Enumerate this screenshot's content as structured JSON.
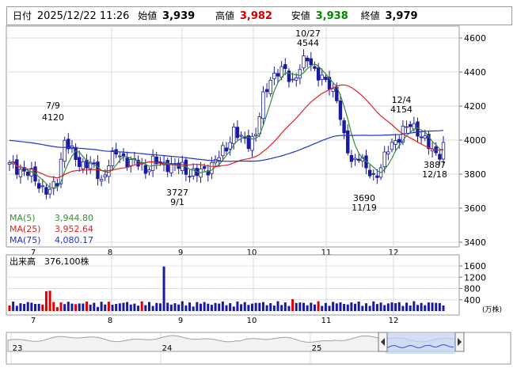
{
  "info": {
    "date_label": "日付",
    "datetime": "2025/12/22 11:26",
    "open_label": "始値",
    "open": "3,939",
    "high_label": "高値",
    "high": "3,982",
    "low_label": "安値",
    "low": "3,938",
    "close_label": "終値",
    "close": "3,979",
    "colors": {
      "high": "#cc0000",
      "low": "#008800"
    }
  },
  "chart_data": {
    "type": "candlestick",
    "y_ticks": [
      "4600",
      "4400",
      "4200",
      "4000",
      "3800",
      "3600",
      "3400"
    ],
    "y_tick_values": [
      4600,
      4400,
      4200,
      4000,
      3800,
      3600,
      3400
    ],
    "x_month_labels": [
      "7",
      "8",
      "9",
      "10",
      "11",
      "12"
    ],
    "legend": [
      {
        "name": "MA(5)",
        "value": "3,944.80",
        "color": "#3a8a3a"
      },
      {
        "name": "MA(25)",
        "value": "3,952.64",
        "color": "#dd2222"
      },
      {
        "name": "MA(75)",
        "value": "4,080.17",
        "color": "#2233cc"
      }
    ],
    "annotations": [
      {
        "date": "7/9",
        "price": "4120"
      },
      {
        "date": "10/27",
        "price": "4544"
      },
      {
        "date": "12/4",
        "price": "4154"
      },
      {
        "price": "3727",
        "date": "9/1"
      },
      {
        "price": "3690",
        "date": "11/19"
      },
      {
        "price": "3887",
        "date": "12/18"
      }
    ],
    "colors": {
      "up": "#ffffff",
      "down": "#1a1a9e",
      "outline": "#1a1a9e",
      "volume": "#1a1a9e",
      "volume_highlight": "#dd0000"
    }
  },
  "volume": {
    "title": "出来高",
    "value": "376,100株",
    "y_ticks": [
      "1600",
      "1200",
      "800",
      "400"
    ],
    "unit": "(万株)"
  },
  "navigator": {
    "year_labels": [
      "23",
      "24",
      "25"
    ],
    "handle_left_icon": "chevron-left-icon",
    "handle_right_icon": "chevron-right-icon"
  }
}
